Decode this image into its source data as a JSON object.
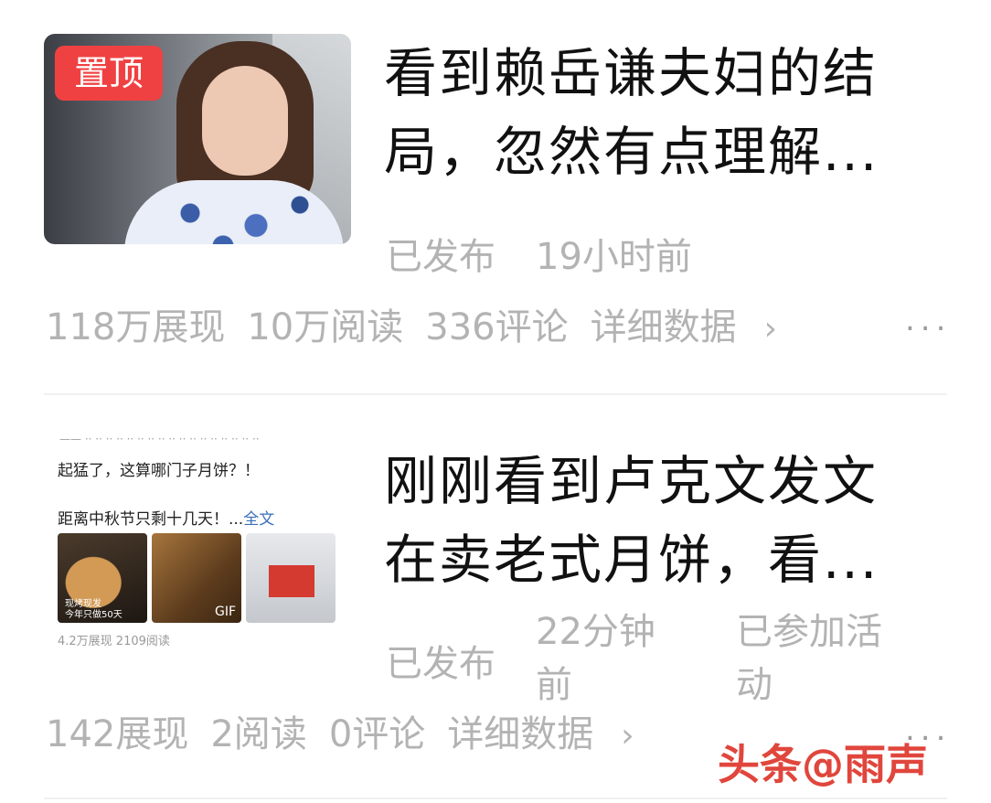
{
  "articles": [
    {
      "badge": "置顶",
      "title_line1": "看到赖岳谦夫妇的结",
      "title_line2": "局，忽然有点理解...",
      "status": "已发布",
      "time": "19小时前",
      "impressions": "118万展现",
      "reads": "10万阅读",
      "comments": "336评论",
      "details_link": "详细数据",
      "more": "..."
    },
    {
      "title_line1": "刚刚看到卢克文发文",
      "title_line2": "在卖老式月饼，看...",
      "status": "已发布",
      "time_line1": "22分钟",
      "time_line2": "前",
      "activity_line1": "已参加活",
      "activity_line2": "动",
      "impressions": "142展现",
      "reads": "2阅读",
      "comments": "0评论",
      "details_link": "详细数据",
      "more": "...",
      "thumbnail": {
        "line1": "起猛了，这算哪门子月饼？！",
        "line2": "距离中秋节只剩十几天！...",
        "full_text_link": "全文",
        "caption": "现烤现发\n今年只做50天",
        "gif_label": "GIF",
        "stats": "4.2万展现  2109阅读"
      }
    }
  ],
  "icons": {
    "chevron": "›"
  },
  "watermark": "头条@雨声",
  "colors": {
    "badge_bg": "#f04142",
    "meta_text": "#b3b3b3",
    "title_text": "#111111",
    "watermark": "#e0463c"
  }
}
